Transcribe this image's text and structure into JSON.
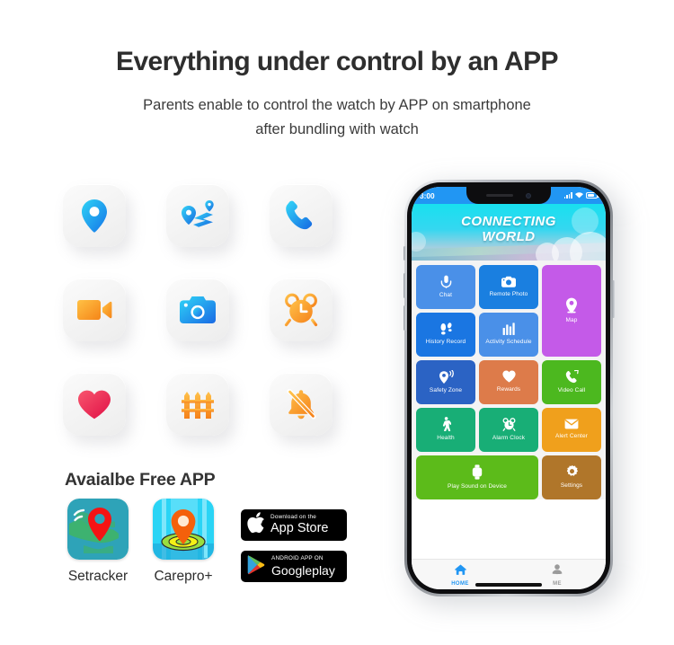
{
  "header": {
    "headline": "Everything under control by an APP",
    "subline_line1": "Parents enable to control the watch by APP on smartphone",
    "subline_line2": "after bundling with watch"
  },
  "features": {
    "icons": [
      {
        "name": "location-pin-icon",
        "label": "Location"
      },
      {
        "name": "route-map-icon",
        "label": "Route Tracking"
      },
      {
        "name": "phone-call-icon",
        "label": "Phone Call"
      },
      {
        "name": "video-camera-icon",
        "label": "Video Call"
      },
      {
        "name": "photo-camera-icon",
        "label": "Remote Camera"
      },
      {
        "name": "alarm-clock-icon",
        "label": "Alarm Clock"
      },
      {
        "name": "heart-icon",
        "label": "Health"
      },
      {
        "name": "fence-icon",
        "label": "Geo Fence"
      },
      {
        "name": "bell-off-icon",
        "label": "Silent Mode"
      }
    ]
  },
  "apps": {
    "title": "Avaialbe Free APP",
    "items": [
      {
        "label": "Setracker",
        "icon": "setracker-app-icon"
      },
      {
        "label": "Carepro+",
        "icon": "carepro-app-icon"
      }
    ],
    "stores": [
      {
        "icon": "apple-logo-icon",
        "small": "Download on the",
        "big": "App Store"
      },
      {
        "icon": "google-play-logo-icon",
        "small": "ANDROID APP ON",
        "big": "Google",
        "big2": "play"
      }
    ]
  },
  "phone": {
    "statusbar": {
      "time": "3:00",
      "signal_icon": "signal-bars-icon",
      "wifi_icon": "wifi-icon",
      "battery_icon": "battery-icon"
    },
    "banner": {
      "title_line1": "CONNECTING",
      "title_line2": "WORLD"
    },
    "tiles": [
      {
        "label": "Chat",
        "icon": "microphone-icon",
        "color": "#4a90e8"
      },
      {
        "label": "Remote Photo",
        "icon": "camera-icon",
        "color": "#1a7fe0"
      },
      {
        "label": "Map",
        "icon": "map-pin-icon",
        "color": "#c45ae8"
      },
      {
        "label": "History Record",
        "icon": "footprints-icon",
        "color": "#1a76e2"
      },
      {
        "label": "Activity Schedule",
        "icon": "bar-chart-icon",
        "color": "#4a90e8"
      },
      {
        "label": "Safety Zone",
        "icon": "safety-zone-icon",
        "color": "#2b63c4"
      },
      {
        "label": "Rewards",
        "icon": "heart-icon",
        "color": "#dd7b4a"
      },
      {
        "label": "Video Call",
        "icon": "video-phone-icon",
        "color": "#4cb81f"
      },
      {
        "label": "Health",
        "icon": "walking-person-icon",
        "color": "#18ae76"
      },
      {
        "label": "Alarm Clock",
        "icon": "alarm-icon",
        "color": "#18ae76"
      },
      {
        "label": "Alert Center",
        "icon": "envelope-icon",
        "color": "#f0a01c"
      },
      {
        "label": "Play Sound on Device",
        "icon": "watch-icon",
        "color": "#5cbb1a"
      },
      {
        "label": "Settings",
        "icon": "gear-icon",
        "color": "#b0762a"
      }
    ],
    "nav": [
      {
        "label": "HOME",
        "icon": "home-icon",
        "active": true
      },
      {
        "label": "ME",
        "icon": "person-icon",
        "active": false
      }
    ]
  }
}
